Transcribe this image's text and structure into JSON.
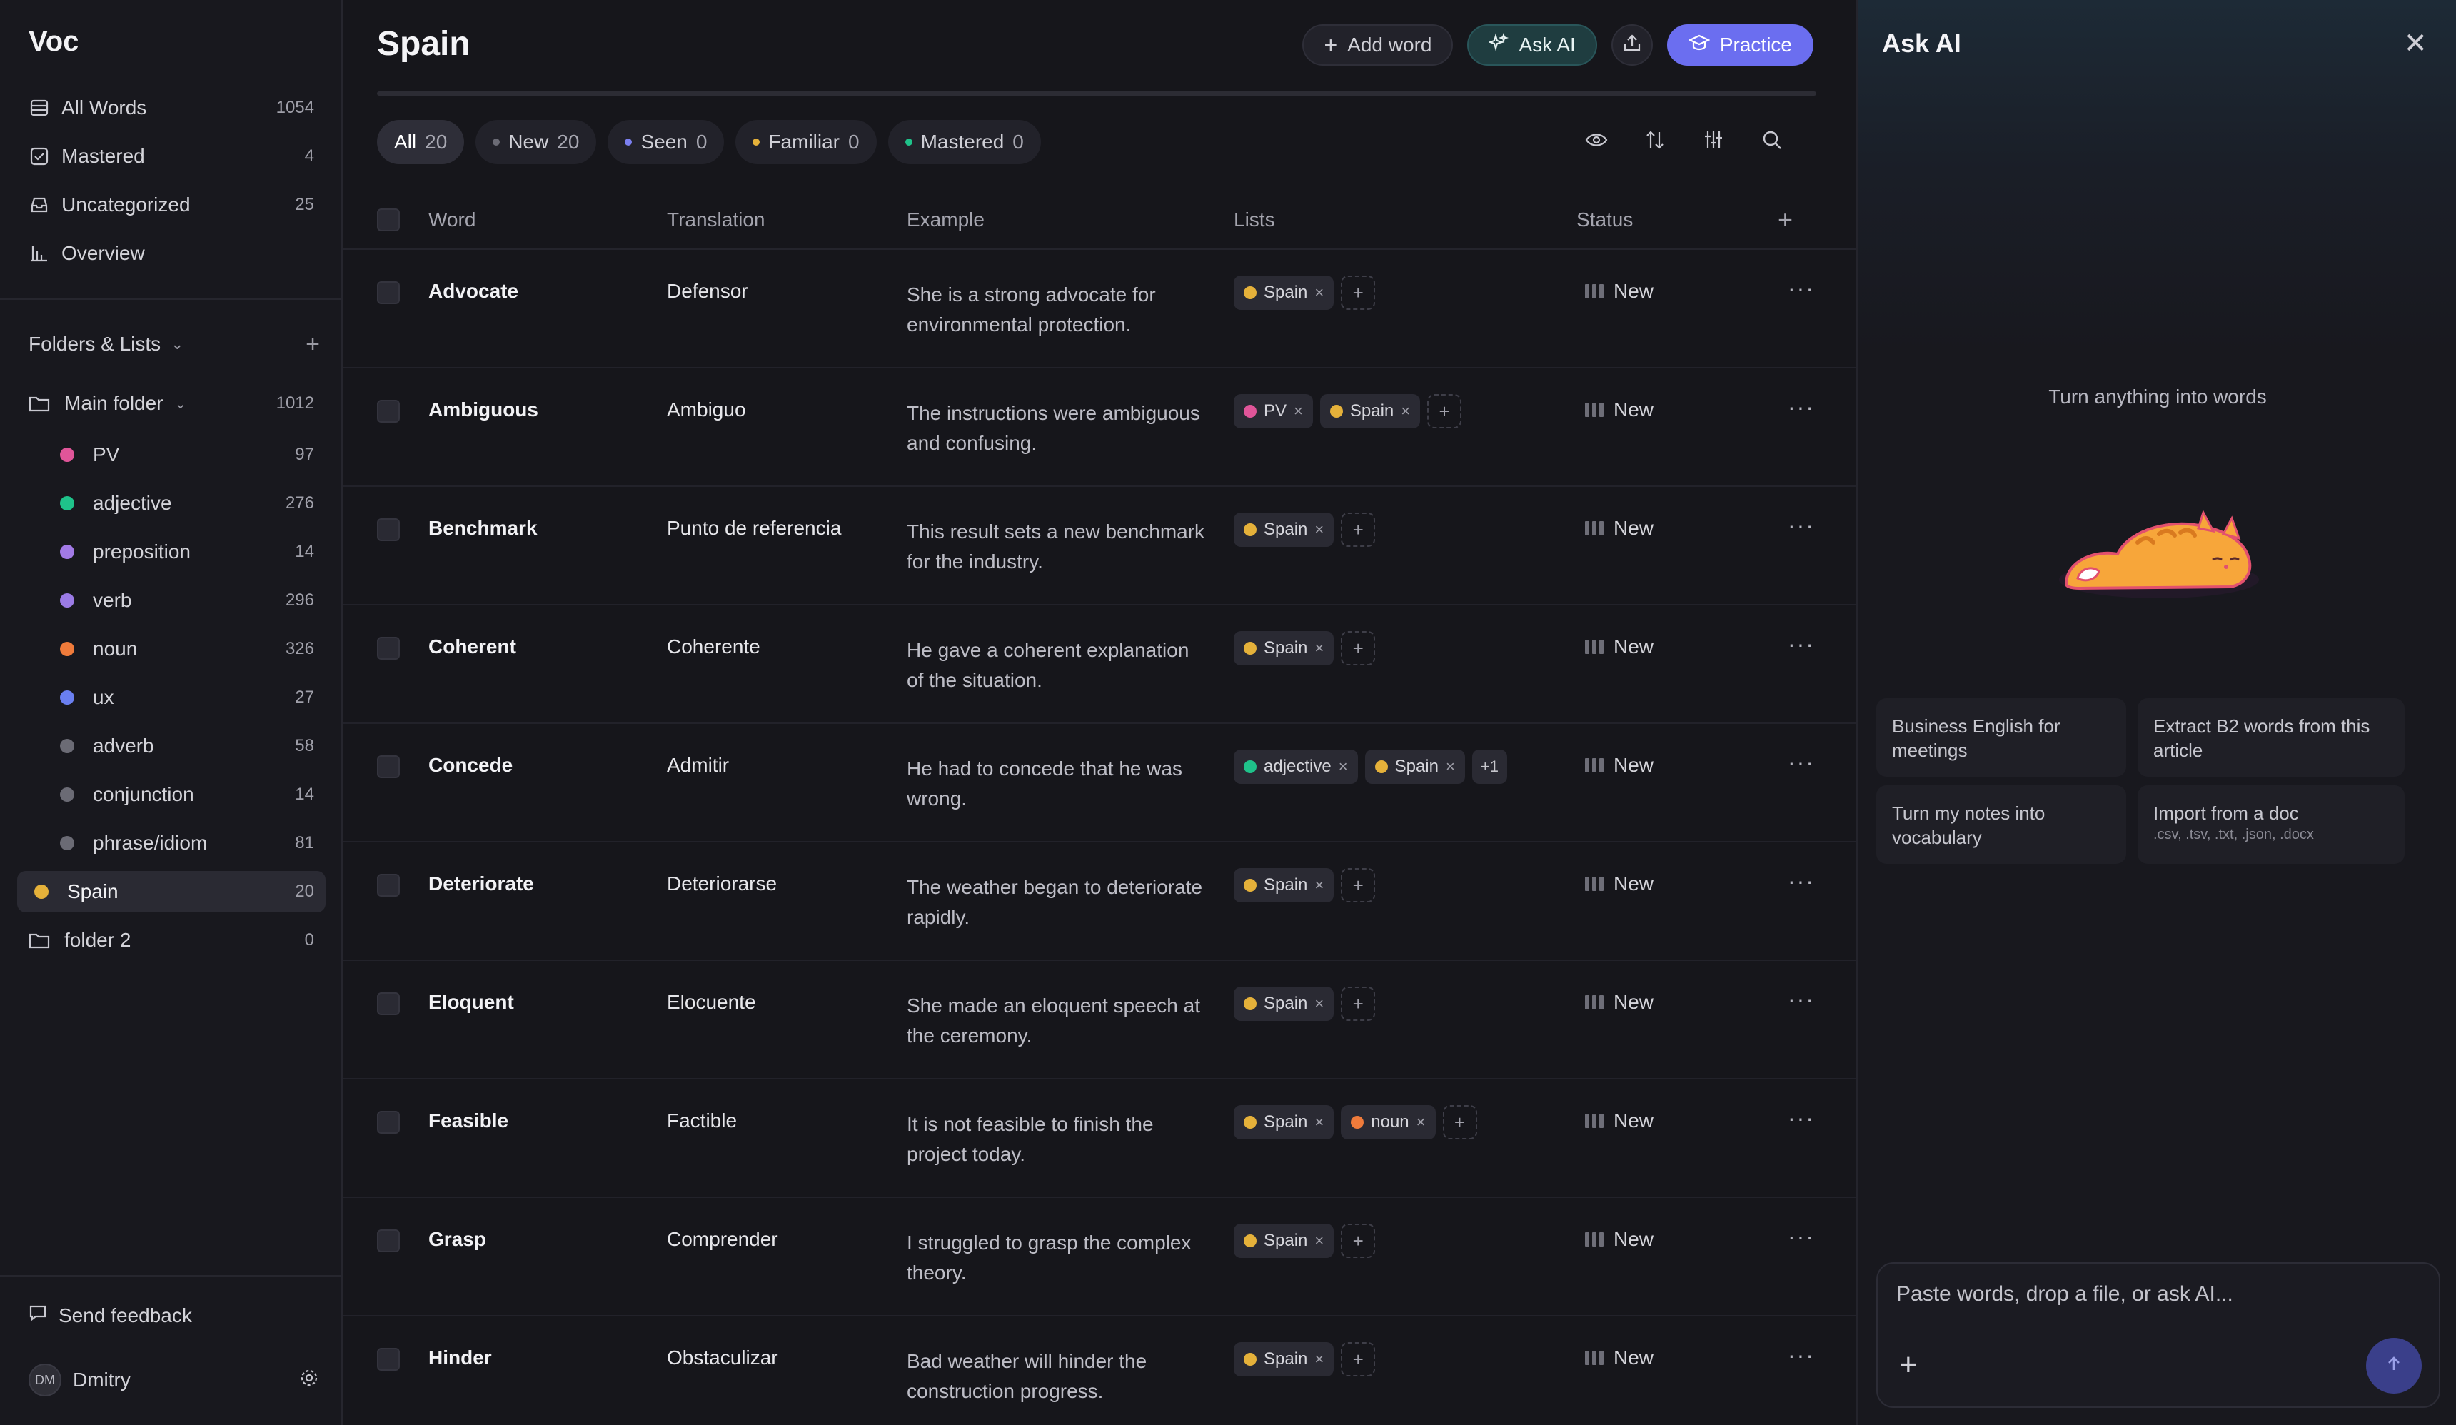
{
  "app": {
    "title": "Voc"
  },
  "sidebar": {
    "nav": [
      {
        "label": "All Words",
        "count": "1054",
        "icon": "list-icon"
      },
      {
        "label": "Mastered",
        "count": "4",
        "icon": "checkbox-icon"
      },
      {
        "label": "Uncategorized",
        "count": "25",
        "icon": "inbox-icon"
      },
      {
        "label": "Overview",
        "count": "",
        "icon": "bar-chart-icon"
      }
    ],
    "folders_label": "Folders & Lists",
    "main_folder": {
      "label": "Main folder",
      "count": "1012"
    },
    "lists": [
      {
        "label": "PV",
        "count": "97",
        "color": "#e05599"
      },
      {
        "label": "adjective",
        "count": "276",
        "color": "#1fc28a"
      },
      {
        "label": "preposition",
        "count": "14",
        "color": "#a27ae6"
      },
      {
        "label": "verb",
        "count": "296",
        "color": "#9b7be6"
      },
      {
        "label": "noun",
        "count": "326",
        "color": "#ef7b3b"
      },
      {
        "label": "ux",
        "count": "27",
        "color": "#6a7ff0"
      },
      {
        "label": "adverb",
        "count": "58",
        "color": "#6b6b75"
      },
      {
        "label": "conjunction",
        "count": "14",
        "color": "#6b6b75"
      },
      {
        "label": "phrase/idiom",
        "count": "81",
        "color": "#6b6b75"
      }
    ],
    "active_list": {
      "label": "Spain",
      "count": "20",
      "color": "#e5b13a"
    },
    "folder2": {
      "label": "folder 2",
      "count": "0"
    },
    "feedback_label": "Send feedback",
    "user": {
      "initials": "DM",
      "name": "Dmitry"
    }
  },
  "main": {
    "title": "Spain",
    "actions": {
      "add_word": "Add word",
      "ask_ai": "Ask AI",
      "practice": "Practice"
    },
    "filters": [
      {
        "label": "All",
        "count": "20",
        "dot": ""
      },
      {
        "label": "New",
        "count": "20",
        "dot": "#6b6b75"
      },
      {
        "label": "Seen",
        "count": "0",
        "dot": "#7b7ff0"
      },
      {
        "label": "Familiar",
        "count": "0",
        "dot": "#e5b13a"
      },
      {
        "label": "Mastered",
        "count": "0",
        "dot": "#1fc28a"
      }
    ],
    "columns": {
      "word": "Word",
      "translation": "Translation",
      "example": "Example",
      "lists": "Lists",
      "status": "Status"
    },
    "rows": [
      {
        "word": "Advocate",
        "translation": "Defensor",
        "example": "She is a strong advocate for environmental protection.",
        "status": "New",
        "tags": [
          {
            "label": "Spain",
            "color": "#e5b13a"
          }
        ]
      },
      {
        "word": "Ambiguous",
        "translation": "Ambiguo",
        "example": "The instructions were ambiguous and confusing.",
        "status": "New",
        "tags": [
          {
            "label": "PV",
            "color": "#e05599"
          },
          {
            "label": "Spain",
            "color": "#e5b13a"
          }
        ]
      },
      {
        "word": "Benchmark",
        "translation": "Punto de referencia",
        "example": "This result sets a new benchmark for the industry.",
        "status": "New",
        "tags": [
          {
            "label": "Spain",
            "color": "#e5b13a"
          }
        ]
      },
      {
        "word": "Coherent",
        "translation": "Coherente",
        "example": "He gave a coherent explanation of the situation.",
        "status": "New",
        "tags": [
          {
            "label": "Spain",
            "color": "#e5b13a"
          }
        ]
      },
      {
        "word": "Concede",
        "translation": "Admitir",
        "example": "He had to concede that he was wrong.",
        "status": "New",
        "tags": [
          {
            "label": "adjective",
            "color": "#1fc28a"
          },
          {
            "label": "Spain",
            "color": "#e5b13a"
          }
        ],
        "more": "+1"
      },
      {
        "word": "Deteriorate",
        "translation": "Deteriorarse",
        "example": "The weather began to deteriorate rapidly.",
        "status": "New",
        "tags": [
          {
            "label": "Spain",
            "color": "#e5b13a"
          }
        ]
      },
      {
        "word": "Eloquent",
        "translation": "Elocuente",
        "example": "She made an eloquent speech at the ceremony.",
        "status": "New",
        "tags": [
          {
            "label": "Spain",
            "color": "#e5b13a"
          }
        ]
      },
      {
        "word": "Feasible",
        "translation": "Factible",
        "example": "It is not feasible to finish the project today.",
        "status": "New",
        "tags": [
          {
            "label": "Spain",
            "color": "#e5b13a"
          },
          {
            "label": "noun",
            "color": "#ef7b3b"
          }
        ]
      },
      {
        "word": "Grasp",
        "translation": "Comprender",
        "example": "I struggled to grasp the complex theory.",
        "status": "New",
        "tags": [
          {
            "label": "Spain",
            "color": "#e5b13a"
          }
        ]
      },
      {
        "word": "Hinder",
        "translation": "Obstaculizar",
        "example": "Bad weather will hinder the construction progress.",
        "status": "New",
        "tags": [
          {
            "label": "Spain",
            "color": "#e5b13a"
          }
        ]
      }
    ]
  },
  "ai_panel": {
    "title": "Ask AI",
    "tagline": "Turn anything into words",
    "suggestions": [
      {
        "label": "Business English for meetings",
        "sub": ""
      },
      {
        "label": "Extract B2 words from this article",
        "sub": ""
      },
      {
        "label": "Turn my notes into vocabulary",
        "sub": ""
      },
      {
        "label": "Import from a doc",
        "sub": ".csv, .tsv, .txt, .json, .docx"
      }
    ],
    "input_placeholder": "Paste words, drop a file, or ask AI..."
  }
}
